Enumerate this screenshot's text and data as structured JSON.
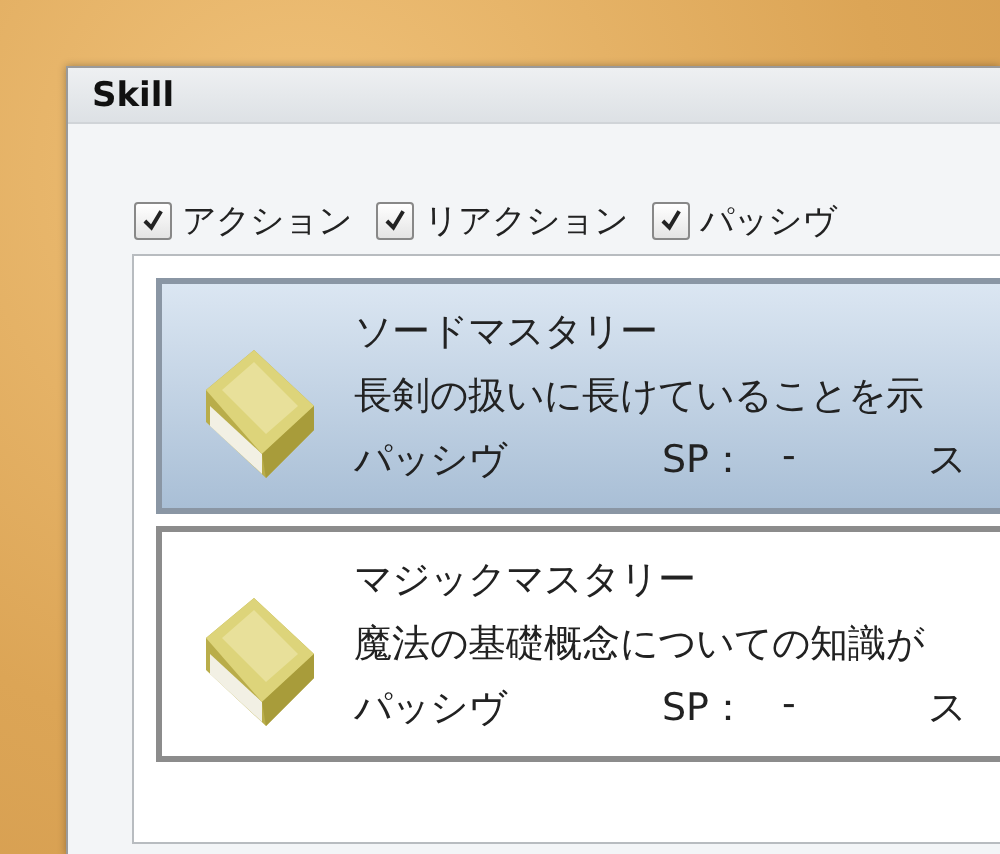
{
  "window": {
    "title": "Skill"
  },
  "filters": [
    {
      "label": "アクション",
      "checked": true
    },
    {
      "label": "リアクション",
      "checked": true
    },
    {
      "label": "パッシヴ",
      "checked": true
    }
  ],
  "skills": [
    {
      "name": "ソードマスタリー",
      "description": "長剣の扱いに長けていることを示",
      "type": "パッシヴ",
      "sp_label": "SP：",
      "sp_value": "-",
      "column_3": "ス",
      "selected": true
    },
    {
      "name": "マジックマスタリー",
      "description": "魔法の基礎概念についての知識が",
      "type": "パッシヴ",
      "sp_label": "SP：",
      "sp_value": "-",
      "column_3": "ス",
      "selected": false
    }
  ]
}
